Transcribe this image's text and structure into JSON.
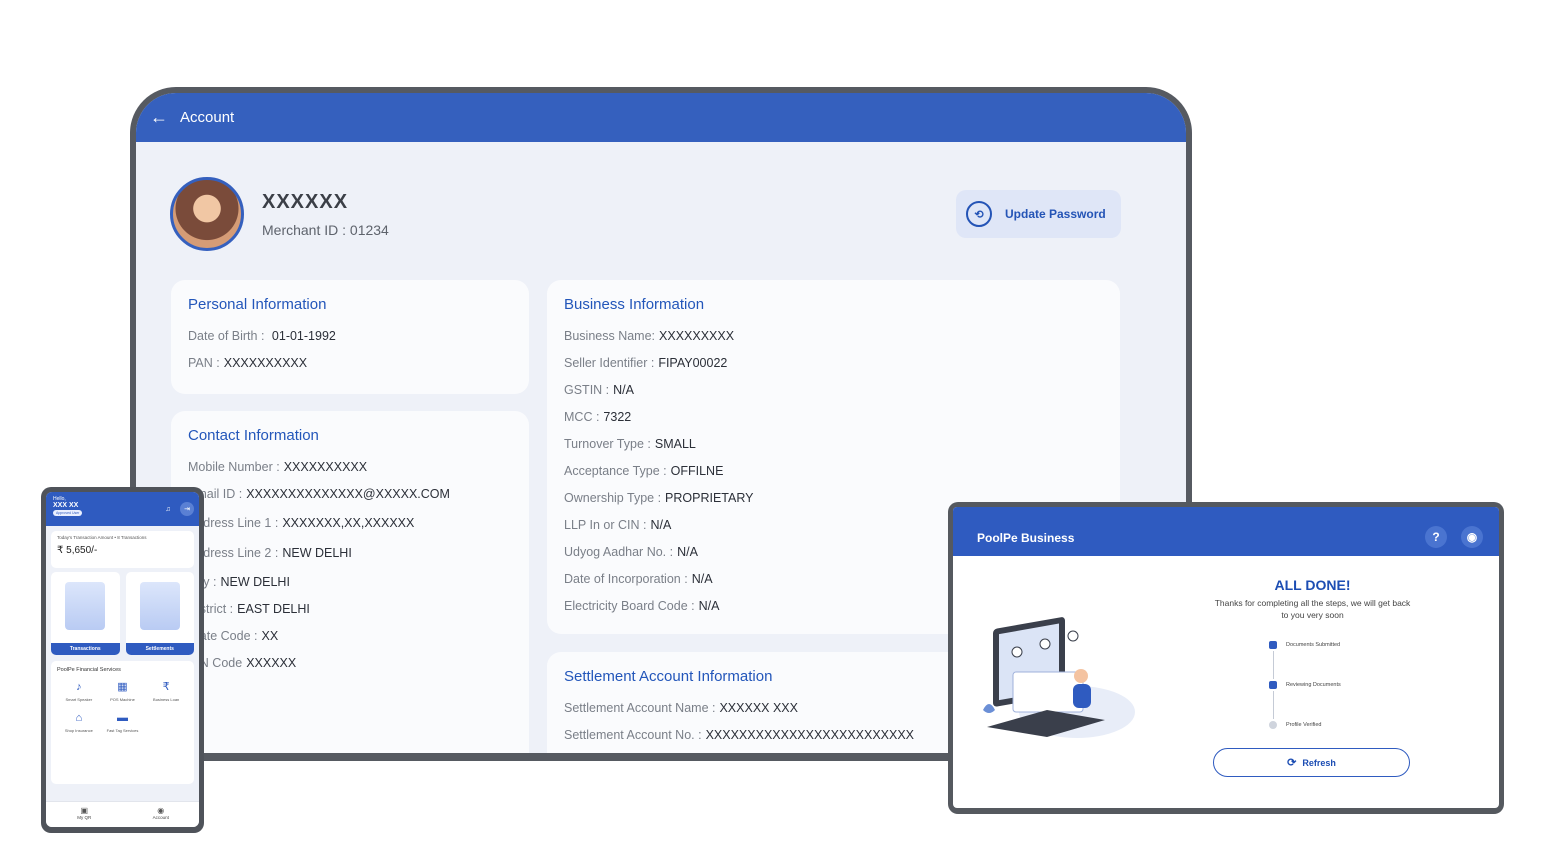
{
  "tablet": {
    "header_title": "Account",
    "profile_name": "XXXXXX",
    "merchant_id": "Merchant ID : 01234",
    "update_password": "Update Password",
    "personal": {
      "title": "Personal Information",
      "rows": [
        {
          "label": "Date of Birth :",
          "value": " 01-01-1992"
        },
        {
          "label": "PAN :",
          "value": "XXXXXXXXXX"
        }
      ]
    },
    "contact": {
      "title": "Contact Information",
      "rows": [
        {
          "label": "Mobile Number :",
          "value": "XXXXXXXXXX"
        },
        {
          "label": "Email ID :",
          "value": "XXXXXXXXXXXXXX@XXXXX.COM"
        },
        {
          "label": "Address Line 1 :",
          "value": "XXXXXXX,XX,XXXXXX"
        },
        {
          "label": "Address Line 2 :",
          "value": "NEW DELHI"
        },
        {
          "label": "City :",
          "value": "NEW DELHI"
        },
        {
          "label": "District :",
          "value": "EAST DELHI"
        },
        {
          "label": "State Code :",
          "value": "XX"
        },
        {
          "label": "PIN Code",
          "value": "XXXXXX"
        }
      ]
    },
    "business": {
      "title": "Business Information",
      "rows": [
        {
          "label": "Business Name:",
          "value": "XXXXXXXXX"
        },
        {
          "label": "Seller Identifier :",
          "value": "FIPAY00022"
        },
        {
          "label": "GSTIN :",
          "value": "N/A"
        },
        {
          "label": "MCC :",
          "value": "7322"
        },
        {
          "label": "Turnover Type :",
          "value": "SMALL"
        },
        {
          "label": "Acceptance Type :",
          "value": "OFFILNE"
        },
        {
          "label": "Ownership Type :",
          "value": "PROPRIETARY"
        },
        {
          "label": "LLP In or CIN :",
          "value": "N/A"
        },
        {
          "label": "Udyog Aadhar No. :",
          "value": "N/A"
        },
        {
          "label": "Date of Incorporation :",
          "value": "N/A"
        },
        {
          "label": "Electricity Board Code :",
          "value": "N/A"
        }
      ]
    },
    "settlement": {
      "title": "Settlement Account Information",
      "rows": [
        {
          "label": "Settlement Account Name :",
          "value": "XXXXXX XXX"
        },
        {
          "label": "Settlement Account No. :",
          "value": "XXXXXXXXXXXXXXXXXXXXXXXXX"
        }
      ]
    }
  },
  "phone": {
    "hello": "Hello,",
    "name": "XXX XX",
    "badge": "Approved User",
    "txn_label": "Today's Transaction Amount • 8 Transactions",
    "txn_amount": "₹ 5,650/-",
    "tiles": [
      "Transactions",
      "Settlements"
    ],
    "services_title": "PoolPe Financial Services",
    "services": [
      "Smart Speaker",
      "POS Machine",
      "Business Loan",
      "Shop Insurance",
      "Fast Tag Services"
    ],
    "nav": [
      "My QR",
      "Account"
    ]
  },
  "tab2": {
    "title": "PoolPe Business",
    "heading": "ALL DONE!",
    "message": "Thanks for completing all the steps, we will get back to you very soon",
    "steps": [
      "Documents Submitted",
      "Reviewing Documents",
      "Profile Verified"
    ],
    "refresh": "Refresh"
  },
  "colors": {
    "primary": "#3560be",
    "accent_text": "#2356ba",
    "background": "#eef1f8"
  }
}
